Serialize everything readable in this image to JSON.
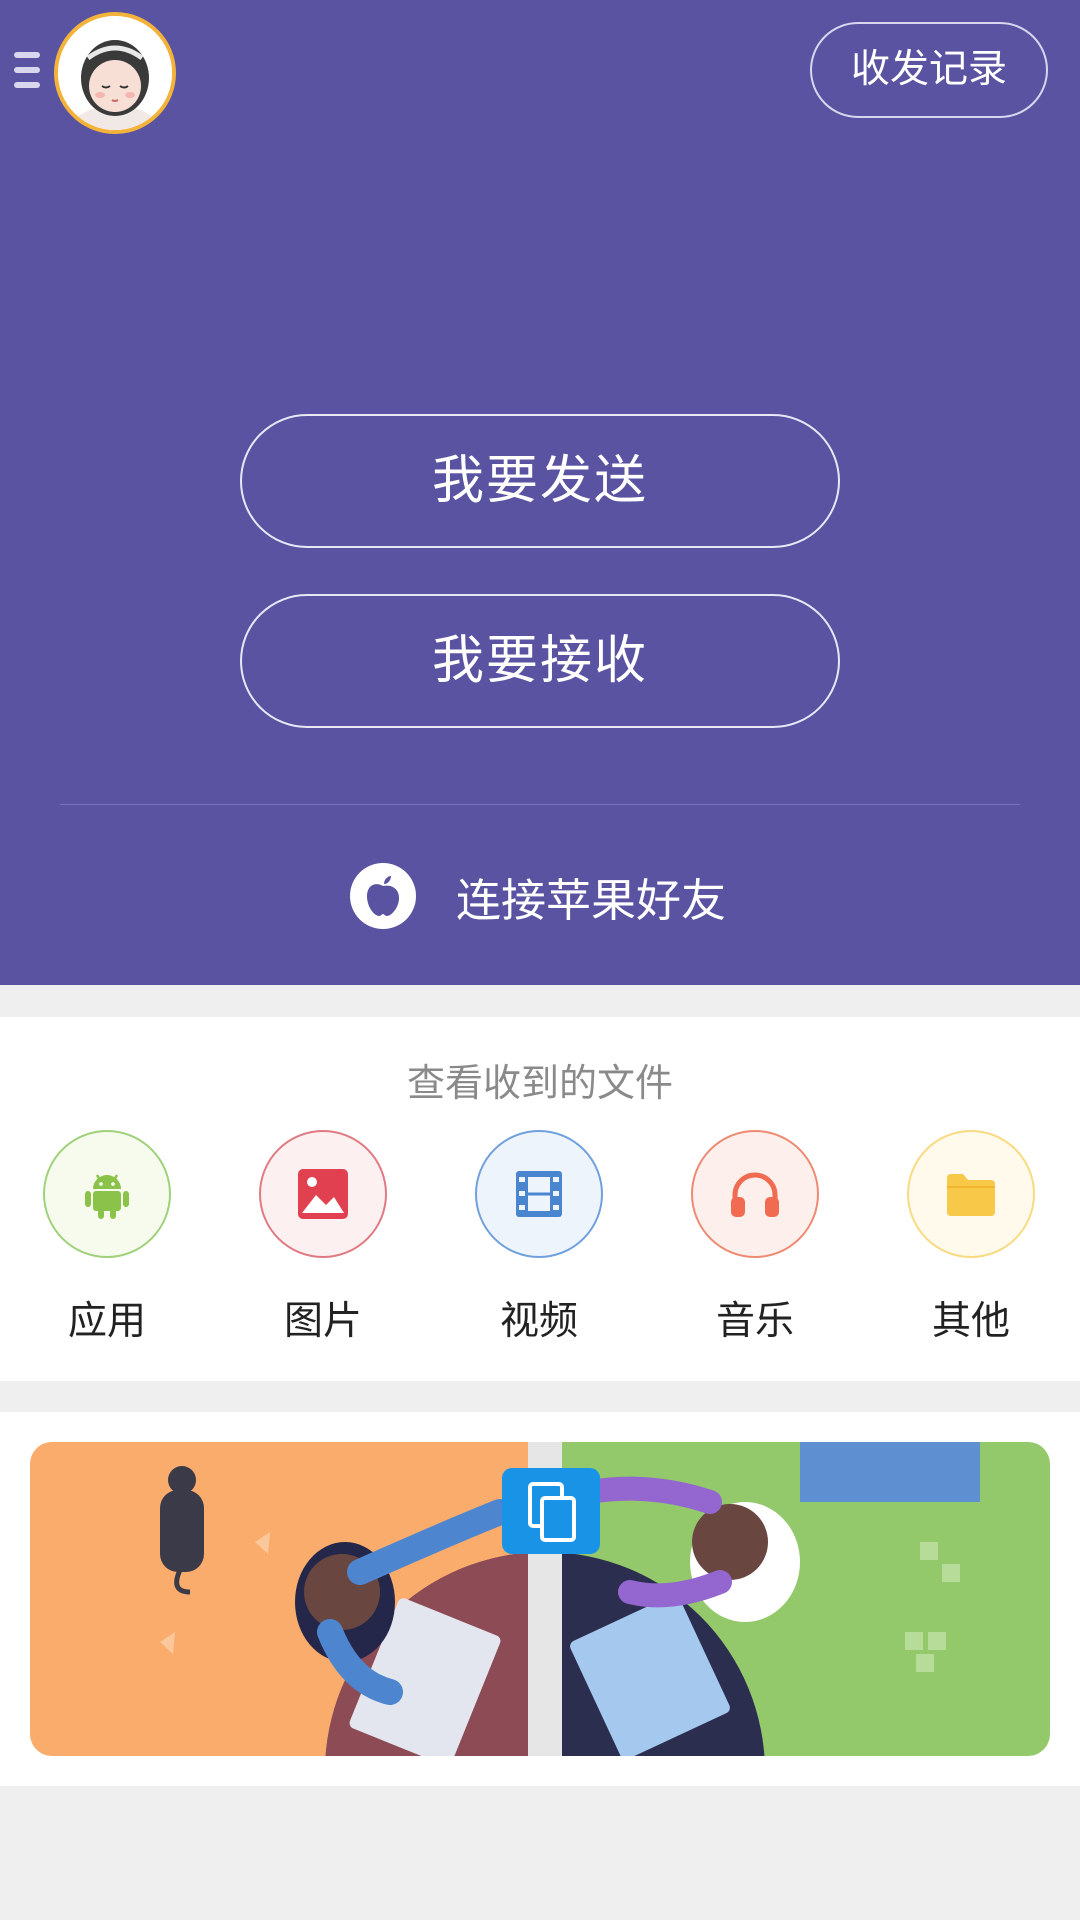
{
  "header": {
    "record_label": "收发记录",
    "menu_icon": "menu-icon",
    "avatar": "avatar"
  },
  "main": {
    "send_label": "我要发送",
    "receive_label": "我要接收",
    "apple_label": "连接苹果好友",
    "apple_icon": "apple-icon"
  },
  "files": {
    "title": "查看收到的文件",
    "categories": [
      {
        "label": "应用",
        "icon": "android-icon",
        "color": "#8bc34a"
      },
      {
        "label": "图片",
        "icon": "image-icon",
        "color": "#e0404f"
      },
      {
        "label": "视频",
        "icon": "video-icon",
        "color": "#4a86cf"
      },
      {
        "label": "音乐",
        "icon": "headphones-icon",
        "color": "#f06b4f"
      },
      {
        "label": "其他",
        "icon": "folder-icon",
        "color": "#f8c848"
      }
    ]
  },
  "colors": {
    "primary": "#5953a1",
    "background": "#efefef"
  }
}
